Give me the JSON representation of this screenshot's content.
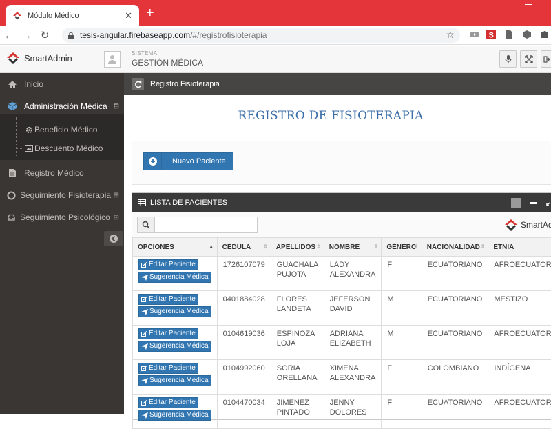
{
  "browser": {
    "tab_title": "Módulo Médico",
    "url_host": "tesis-angular.firebaseapp.com",
    "url_path": "/#/registrofisioterapia"
  },
  "header": {
    "logo_text": "SmartAdmin",
    "system_label": "SISTEMA:",
    "system_value": "GESTIÓN MÉDICA"
  },
  "sidebar": {
    "items": [
      {
        "label": "Inicio"
      },
      {
        "label": "Administración Médica",
        "toggle": "⊟"
      },
      {
        "label": "Registro Médico"
      },
      {
        "label": "Seguimiento Fisioterapia",
        "toggle": "⊞"
      },
      {
        "label": "Seguimiento Psicológico",
        "toggle": "⊞"
      }
    ],
    "subitems": [
      {
        "label": "Beneficio Médico"
      },
      {
        "label": "Descuento Médico"
      }
    ]
  },
  "ribbon": {
    "breadcrumb": "Registro Fisioterapia"
  },
  "main": {
    "title": "REGISTRO DE FISIOTERAPIA",
    "new_button": "Nuevo Paciente",
    "widget_title": "LISTA DE PACIENTES",
    "search_placeholder": "",
    "brand_small": "SmartAdmin"
  },
  "table": {
    "headers": [
      "OPCIONES",
      "CÉDULA",
      "APELLIDOS",
      "NOMBRE",
      "GÉNERO",
      "NACIONALIDAD",
      "ETNIA"
    ],
    "edit_label": "Editar Paciente",
    "suggest_label": "Sugerencia Médica",
    "rows": [
      {
        "cedula": "1726107079",
        "apellidos": "GUACHALA PUJOTA",
        "nombre": "LADY ALEXANDRA",
        "genero": "F",
        "nacionalidad": "ECUATORIANO",
        "etnia": "AFROECUATORIANO"
      },
      {
        "cedula": "0401884028",
        "apellidos": "FLORES LANDETA",
        "nombre": "JEFERSON DAVID",
        "genero": "M",
        "nacionalidad": "ECUATORIANO",
        "etnia": "MESTIZO"
      },
      {
        "cedula": "0104619036",
        "apellidos": "ESPINOZA LOJA",
        "nombre": "ADRIANA ELIZABETH",
        "genero": "M",
        "nacionalidad": "ECUATORIANO",
        "etnia": "AFROECUATORIANO"
      },
      {
        "cedula": "0104992060",
        "apellidos": "SORIA ORELLANA",
        "nombre": "XIMENA ALEXANDRA",
        "genero": "F",
        "nacionalidad": "COLOMBIANO",
        "etnia": "INDÍGENA"
      },
      {
        "cedula": "0104470034",
        "apellidos": "JIMENEZ PINTADO",
        "nombre": "JENNY DOLORES",
        "genero": "F",
        "nacionalidad": "ECUATORIANO",
        "etnia": "AFROECUATORIANO"
      }
    ]
  },
  "colors": {
    "tabbar": "#e3353a",
    "sidebar": "#3a3633",
    "primary_button": "#3276b1",
    "title_blue": "#3b6ea8"
  }
}
